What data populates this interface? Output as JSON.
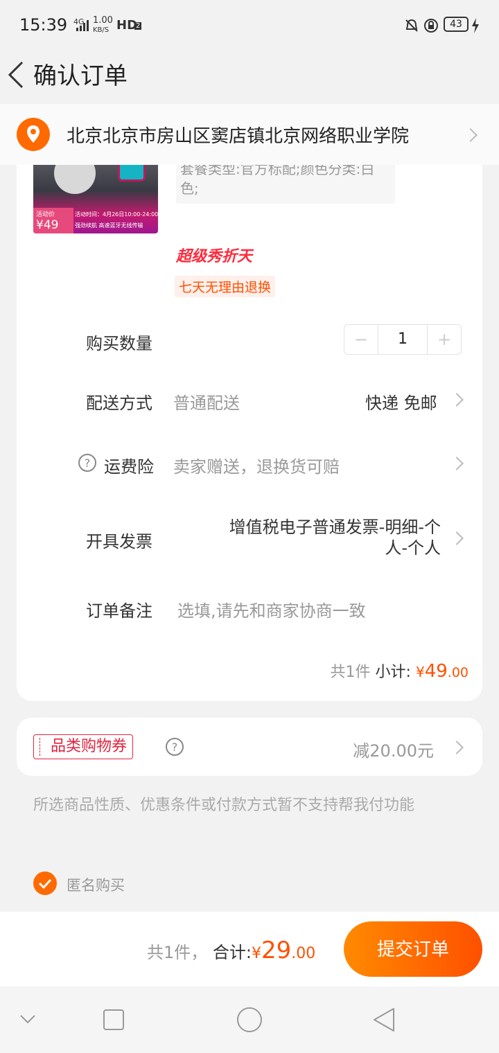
{
  "status_bar": {
    "time": "15:39",
    "network": "4G",
    "speed_value": "1.00",
    "speed_unit": "KB/S",
    "hd": "HD",
    "hd_sub": "2",
    "battery": "43"
  },
  "nav": {
    "title": "确认订单"
  },
  "address": {
    "text": "北京北京市房山区窦店镇北京网络职业学院"
  },
  "product": {
    "image_activity": "活动价",
    "image_price": "¥49",
    "image_time": "活动时间：4月26日10:00-24:00",
    "image_features": "强劲续航  高速蓝牙无线传输",
    "spec_text": "套餐类型:官方标配;颜色分类:白色;",
    "promo_label": "超级秀折天",
    "return_tag": "七天无理由退换"
  },
  "rows": {
    "quantity_label": "购买数量",
    "quantity_value": "1",
    "delivery_label": "配送方式",
    "delivery_value": "普通配送",
    "delivery_right": "快递 免邮",
    "insurance_label": "运费险",
    "insurance_value": "卖家赠送，退换货可赔",
    "invoice_label": "开具发票",
    "invoice_value_line1": "增值税电子普通发票-明细-个",
    "invoice_value_line2": "人-个人",
    "remark_label": "订单备注",
    "remark_placeholder": "选填,请先和商家协商一致"
  },
  "subtotal": {
    "count": "共1件",
    "label": "小计:",
    "currency": "¥",
    "amount": "49",
    "decimal": ".00"
  },
  "coupon": {
    "label": "品类购物券",
    "value": "减20.00元"
  },
  "notice": "所选商品性质、优惠条件或付款方式暂不支持帮我付功能",
  "anonymous_label": "匿名购买",
  "bottom": {
    "count": "共1件，",
    "label": "合计:",
    "currency": "¥",
    "amount": "29",
    "decimal": ".00",
    "submit": "提交订单"
  },
  "colors": {
    "accent": "#ff5000",
    "coupon": "#e2233f"
  }
}
